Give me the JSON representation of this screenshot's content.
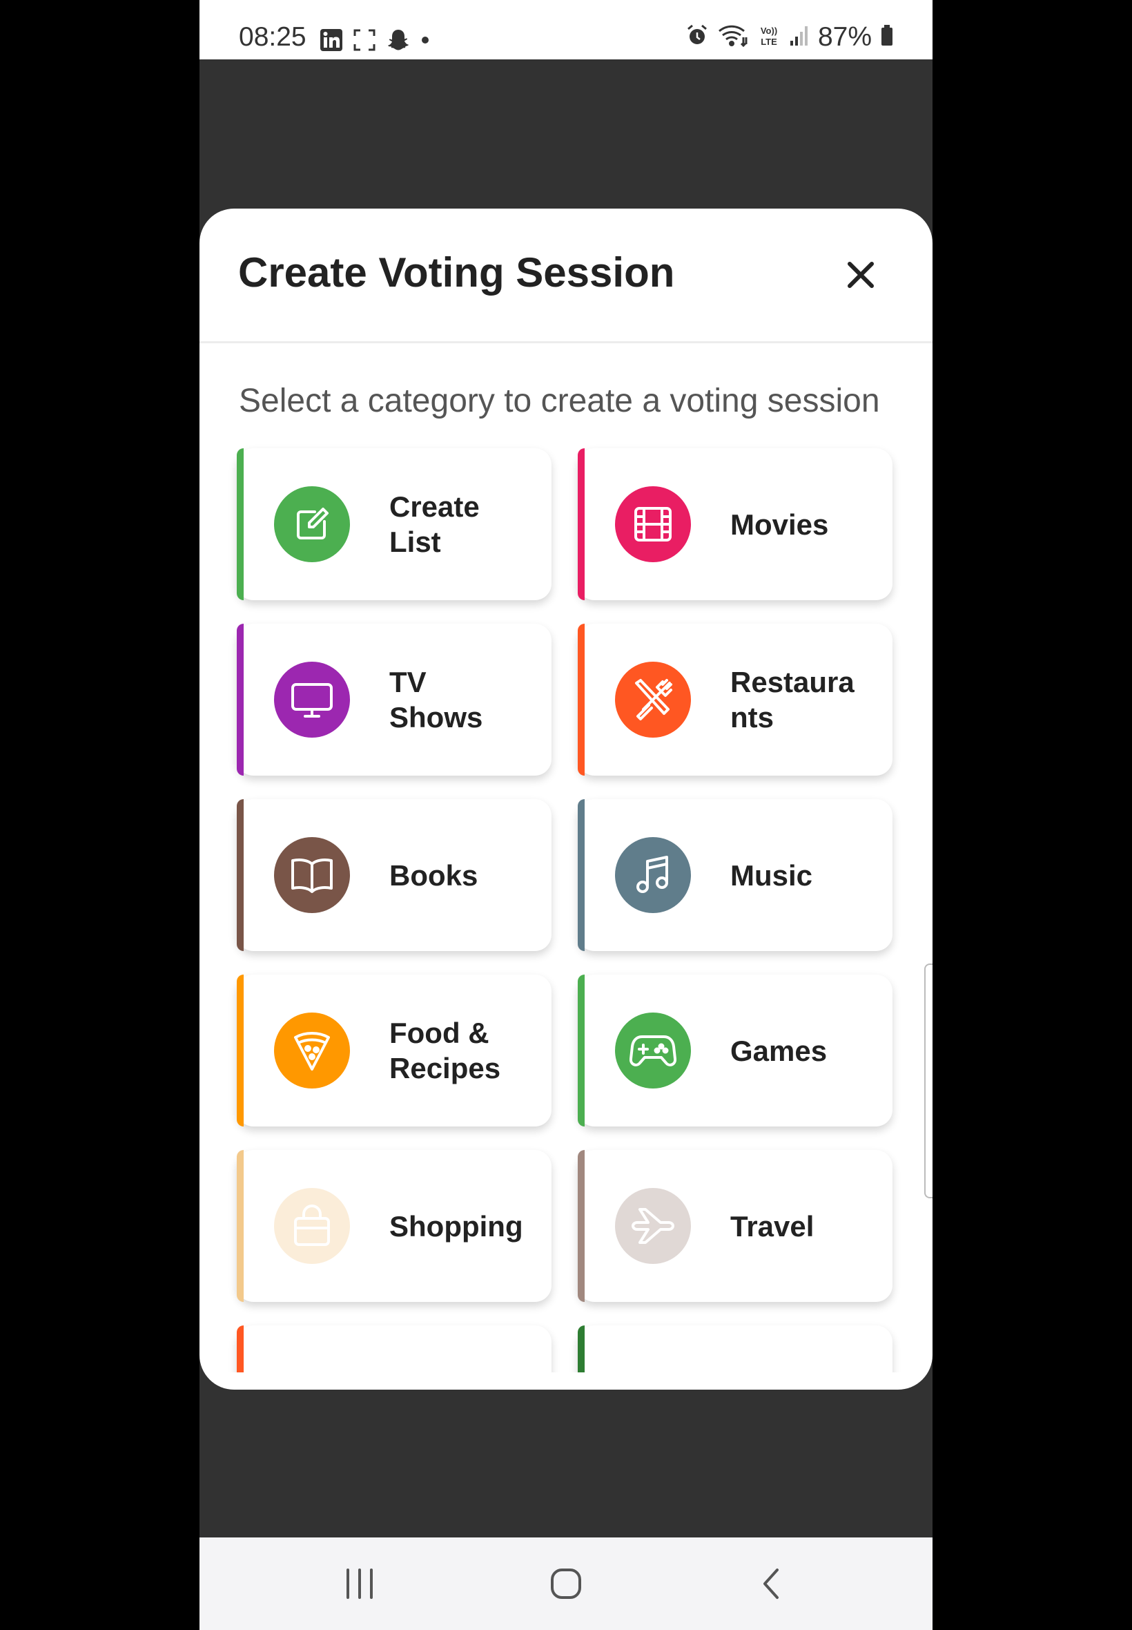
{
  "status_bar": {
    "time": "08:25",
    "battery_pct": "87%",
    "left_icons": [
      "linkedin-icon",
      "screenshot-icon",
      "snapchat-icon",
      "dot-icon"
    ],
    "right_icons": [
      "alarm-icon",
      "wifi-icon",
      "volte-icon",
      "signal-icon",
      "battery-icon"
    ]
  },
  "modal": {
    "title": "Create Voting Session",
    "close_icon": "close-icon",
    "subtitle": "Select a category to create a voting session"
  },
  "categories": [
    {
      "label": "Create\nList",
      "icon": "edit-icon",
      "color": "#4CAF50"
    },
    {
      "label": "Movies",
      "icon": "film-icon",
      "color": "#E91E63"
    },
    {
      "label": "TV\nShows",
      "icon": "tv-icon",
      "color": "#9C27B0"
    },
    {
      "label": "Restaura\nnts",
      "icon": "utensils-icon",
      "color": "#FF5722"
    },
    {
      "label": "Books",
      "icon": "book-icon",
      "color": "#795548"
    },
    {
      "label": "Music",
      "icon": "music-icon",
      "color": "#607D8B"
    },
    {
      "label": "Food &\nRecipes",
      "icon": "pizza-icon",
      "color": "#FF9800"
    },
    {
      "label": "Games",
      "icon": "gamepad-icon",
      "color": "#4CAF50"
    },
    {
      "label": "Shopping",
      "icon": "shopping-bag-icon",
      "color": "#F3C98B"
    },
    {
      "label": "Travel",
      "icon": "airplane-icon",
      "color": "#A1887F"
    }
  ],
  "partial_row_colors": [
    "#FF5722",
    "#2E7D32"
  ],
  "nav_bar": {
    "icons": [
      "recent-apps-icon",
      "home-icon",
      "back-icon"
    ]
  }
}
